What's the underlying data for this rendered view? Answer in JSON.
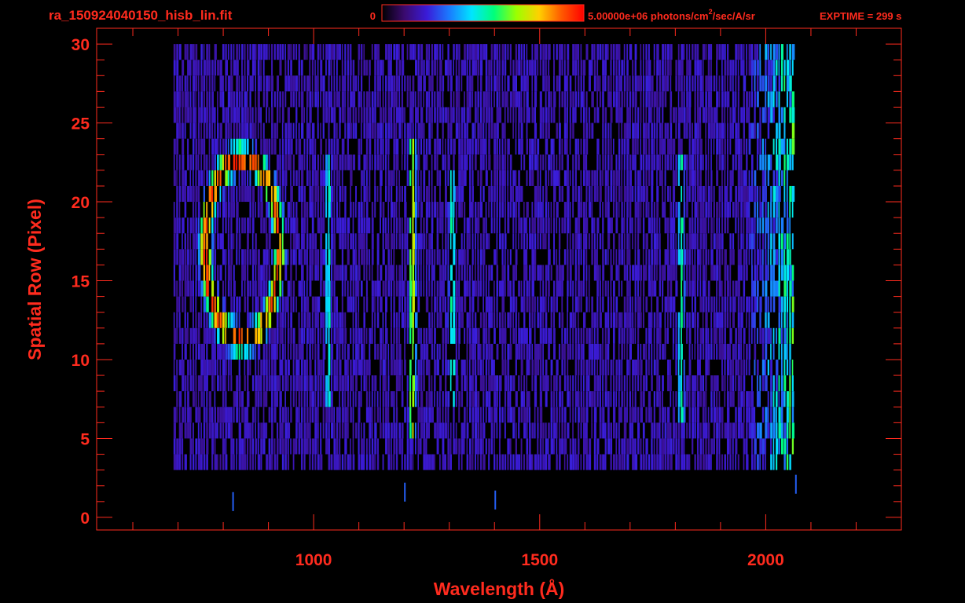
{
  "header": {
    "filename": "ra_150924040150_hisb_lin.fit",
    "colorbar_min": "0",
    "colorbar_max_label": "5.00000e+06 photons/cm",
    "colorbar_max_sup": "2",
    "colorbar_max_suffix": "/sec/A/sr",
    "exptime": "EXPTIME = 299 s"
  },
  "colors": {
    "accent": "#ff2b1e",
    "background": "#000000",
    "colormap": [
      "#000000",
      "#3a0a6e",
      "#3a1bd8",
      "#1a7bff",
      "#00e5ff",
      "#00ff7a",
      "#9cff00",
      "#ffd000",
      "#ff5a00",
      "#ff0000"
    ]
  },
  "chart_data": {
    "type": "heatmap",
    "title": "ra_150924040150_hisb_lin.fit",
    "xlabel": "Wavelength (Å)",
    "ylabel": "Spatial Row (Pixel)",
    "xlim": [
      520,
      2300
    ],
    "ylim": [
      -0.8,
      31
    ],
    "x_ticks": [
      1000,
      1500,
      2000
    ],
    "y_ticks": [
      0,
      5,
      10,
      15,
      20,
      25,
      30
    ],
    "grid": false,
    "colorbar": {
      "min": 0,
      "max": 5000000,
      "units": "photons/cm^2/sec/A/sr",
      "scale": "linear"
    },
    "data_extent": {
      "x": [
        690,
        2060
      ],
      "y": [
        3,
        30
      ]
    },
    "features": [
      {
        "name": "ring",
        "x_center": 840,
        "x_width": 100,
        "y_center": 17,
        "y_extent": [
          10,
          24
        ],
        "peak": 0.95
      },
      {
        "name": "line",
        "x_center": 1030,
        "y_extent": [
          7,
          23
        ],
        "peak": 0.5
      },
      {
        "name": "line",
        "x_center": 1216,
        "y_extent": [
          5,
          24
        ],
        "peak": 0.75
      },
      {
        "name": "line",
        "x_center": 1304,
        "y_extent": [
          7,
          22
        ],
        "peak": 0.55
      },
      {
        "name": "line",
        "x_center": 1811,
        "y_extent": [
          6,
          23
        ],
        "peak": 0.55
      },
      {
        "name": "continuum",
        "x_range": [
          1900,
          2060
        ],
        "y_extent": [
          3,
          30
        ],
        "peak": 0.6
      }
    ]
  }
}
